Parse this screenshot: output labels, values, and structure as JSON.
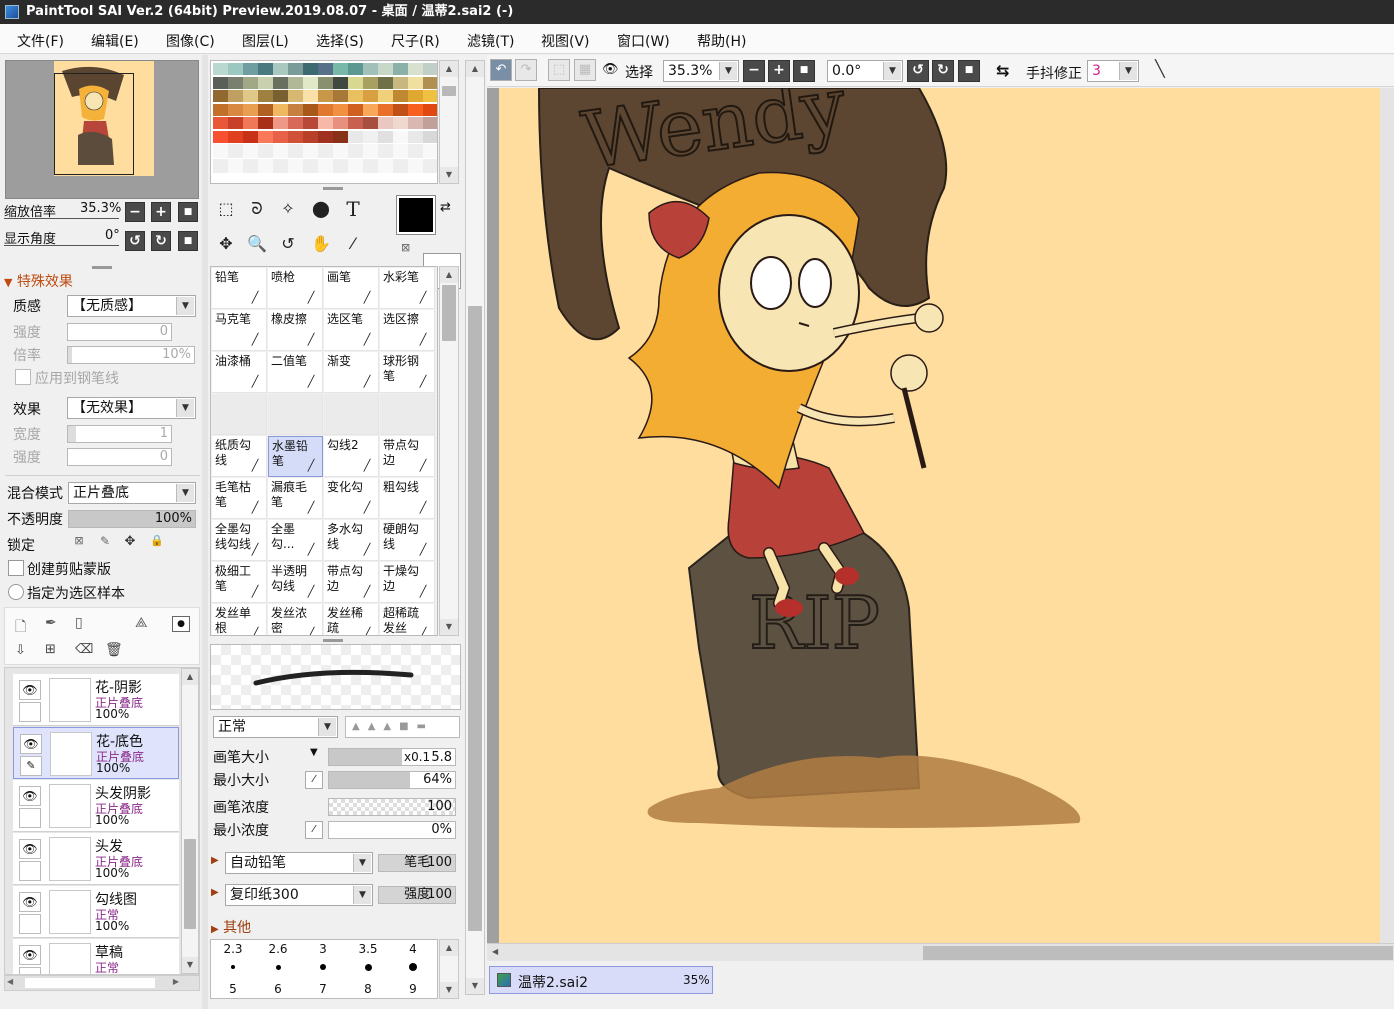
{
  "title": "PaintTool SAI Ver.2 (64bit) Preview.2019.08.07 - 桌面 / 温蒂2.sai2 (-)",
  "menu": [
    "文件(F)",
    "编辑(E)",
    "图像(C)",
    "图层(L)",
    "选择(S)",
    "尺子(R)",
    "滤镜(T)",
    "视图(V)",
    "窗口(W)",
    "帮助(H)"
  ],
  "nav": {
    "zoom_label": "缩放倍率",
    "zoom_value": "35.3%",
    "angle_label": "显示角度",
    "angle_value": "0°"
  },
  "effects": {
    "header": "特殊效果",
    "texture_label": "质感",
    "texture_value": "【无质感】",
    "strength_label": "强度",
    "strength_value": "0",
    "scale_label": "倍率",
    "scale_value": "10%",
    "apply_pen": "应用到钢笔线",
    "effect_label": "效果",
    "effect_value": "【无效果】",
    "width_label": "宽度",
    "width_value": "1",
    "strength2_label": "强度",
    "strength2_value": "0"
  },
  "layer_props": {
    "blend_label": "混合模式",
    "blend_value": "正片叠底",
    "opacity_label": "不透明度",
    "opacity_value": "100%",
    "opacity_fraction": 1.0,
    "lock_label": "锁定",
    "clip_label": "创建剪贴蒙版",
    "sample_label": "指定为选区样本"
  },
  "layers": [
    {
      "name": "花-阴影",
      "mode": "正片叠底",
      "opacity": "100%",
      "selected": false
    },
    {
      "name": "花-底色",
      "mode": "正片叠底",
      "opacity": "100%",
      "selected": true
    },
    {
      "name": "头发阴影",
      "mode": "正片叠底",
      "opacity": "100%",
      "selected": false
    },
    {
      "name": "头发",
      "mode": "正片叠底",
      "opacity": "100%",
      "selected": false
    },
    {
      "name": "勾线图",
      "mode": "正常",
      "opacity": "100%",
      "selected": false
    },
    {
      "name": "草稿",
      "mode": "正常",
      "opacity": "",
      "selected": false
    }
  ],
  "brushes": [
    [
      "铅笔",
      "喷枪",
      "画笔",
      "水彩笔"
    ],
    [
      "马克笔",
      "橡皮擦",
      "选区笔",
      "选区擦"
    ],
    [
      "油漆桶",
      "二值笔",
      "渐变",
      "球形钢笔"
    ],
    [
      "",
      "",
      "",
      ""
    ],
    [
      "纸质勾线",
      "水墨铅笔",
      "勾线2",
      "带点勾边"
    ],
    [
      "毛笔枯笔",
      "漏痕毛笔",
      "变化勾",
      "粗勾线"
    ],
    [
      "全墨勾线勾线",
      "全墨勾...",
      "多水勾线",
      "硬朗勾线"
    ],
    [
      "极细工笔",
      "半透明勾线",
      "带点勾边",
      "干燥勾边"
    ],
    [
      "发丝单根",
      "发丝浓密",
      "发丝稀疏",
      "超稀疏发丝"
    ]
  ],
  "brush_settings": {
    "mode_value": "正常",
    "size_label": "画笔大小",
    "size_mult": "x0.1",
    "size_value": "5.8",
    "min_size_label": "最小大小",
    "min_size_value": "64%",
    "min_size_fraction": 0.64,
    "density_label": "画笔浓度",
    "density_value": "100",
    "min_density_label": "最小浓度",
    "min_density_value": "0%",
    "shape_value": "自动铅笔",
    "shape_param_label": "笔毛",
    "shape_param_value": "100",
    "texture_value": "复印纸300",
    "texture_param_label": "强度",
    "texture_param_value": "100",
    "other_label": "其他",
    "sizes": [
      "2.3",
      "2.6",
      "3",
      "3.5",
      "4"
    ],
    "sizes2": [
      "5",
      "6",
      "7",
      "8",
      "9"
    ]
  },
  "toolbar": {
    "select_label": "选择",
    "zoom_value": "35.3%",
    "angle_value": "0.0°",
    "stab_label": "手抖修正",
    "stab_value": "3"
  },
  "doc_tab": {
    "name": "温蒂2.sai2",
    "zoom": "35%"
  },
  "canvas_art": {
    "flag_text": "Wendy",
    "tomb_text": "RIP"
  },
  "colors": {
    "canvas_bg": "#fedd9f",
    "current_color": "#000000",
    "secondary_color": "#ffffff",
    "selection": "#d4dcf8"
  }
}
